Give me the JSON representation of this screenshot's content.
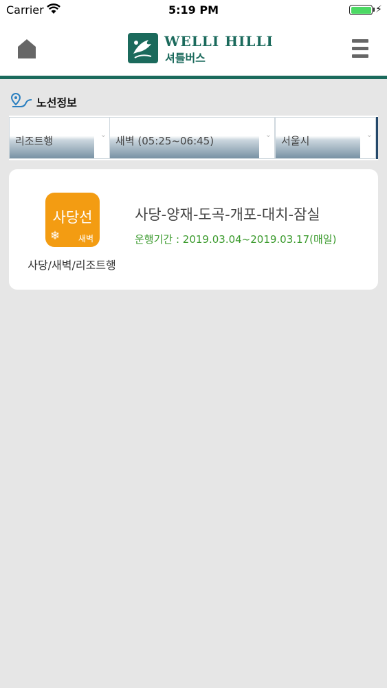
{
  "status_bar": {
    "carrier": "Carrier",
    "time": "5:19 PM",
    "battery_level": 1.0,
    "icons": [
      "wifi-icon",
      "battery-icon",
      "charging-bolt-icon"
    ]
  },
  "header": {
    "home_icon": "home-icon",
    "logo_title": "WELLI HILLI",
    "logo_subtitle": "셔틀버스",
    "menu_icon": "hamburger-menu-icon"
  },
  "section": {
    "icon": "route-pin-icon",
    "title": "노선정보"
  },
  "filters": [
    {
      "value": "리조트행",
      "caret": "⌄"
    },
    {
      "value": "새벽 (05:25~06:45)",
      "caret": "⌄"
    },
    {
      "value": "서울시",
      "caret": "⌄"
    }
  ],
  "routes": [
    {
      "badge_main": "사당선",
      "badge_tag": "새벽",
      "badge_icon": "snowflake-icon",
      "caption": "사당/새벽/리조트행",
      "title": "사당-양재-도곡-개포-대치-잠실",
      "period": "운행기간 : 2019.03.04~2019.03.17(매일)"
    }
  ],
  "colors": {
    "brand_green": "#1b6a5c",
    "badge_orange": "#f39c12",
    "period_green": "#3a9a2c",
    "page_bg": "#e6e6e6",
    "filter_dark": "#7892a4"
  }
}
